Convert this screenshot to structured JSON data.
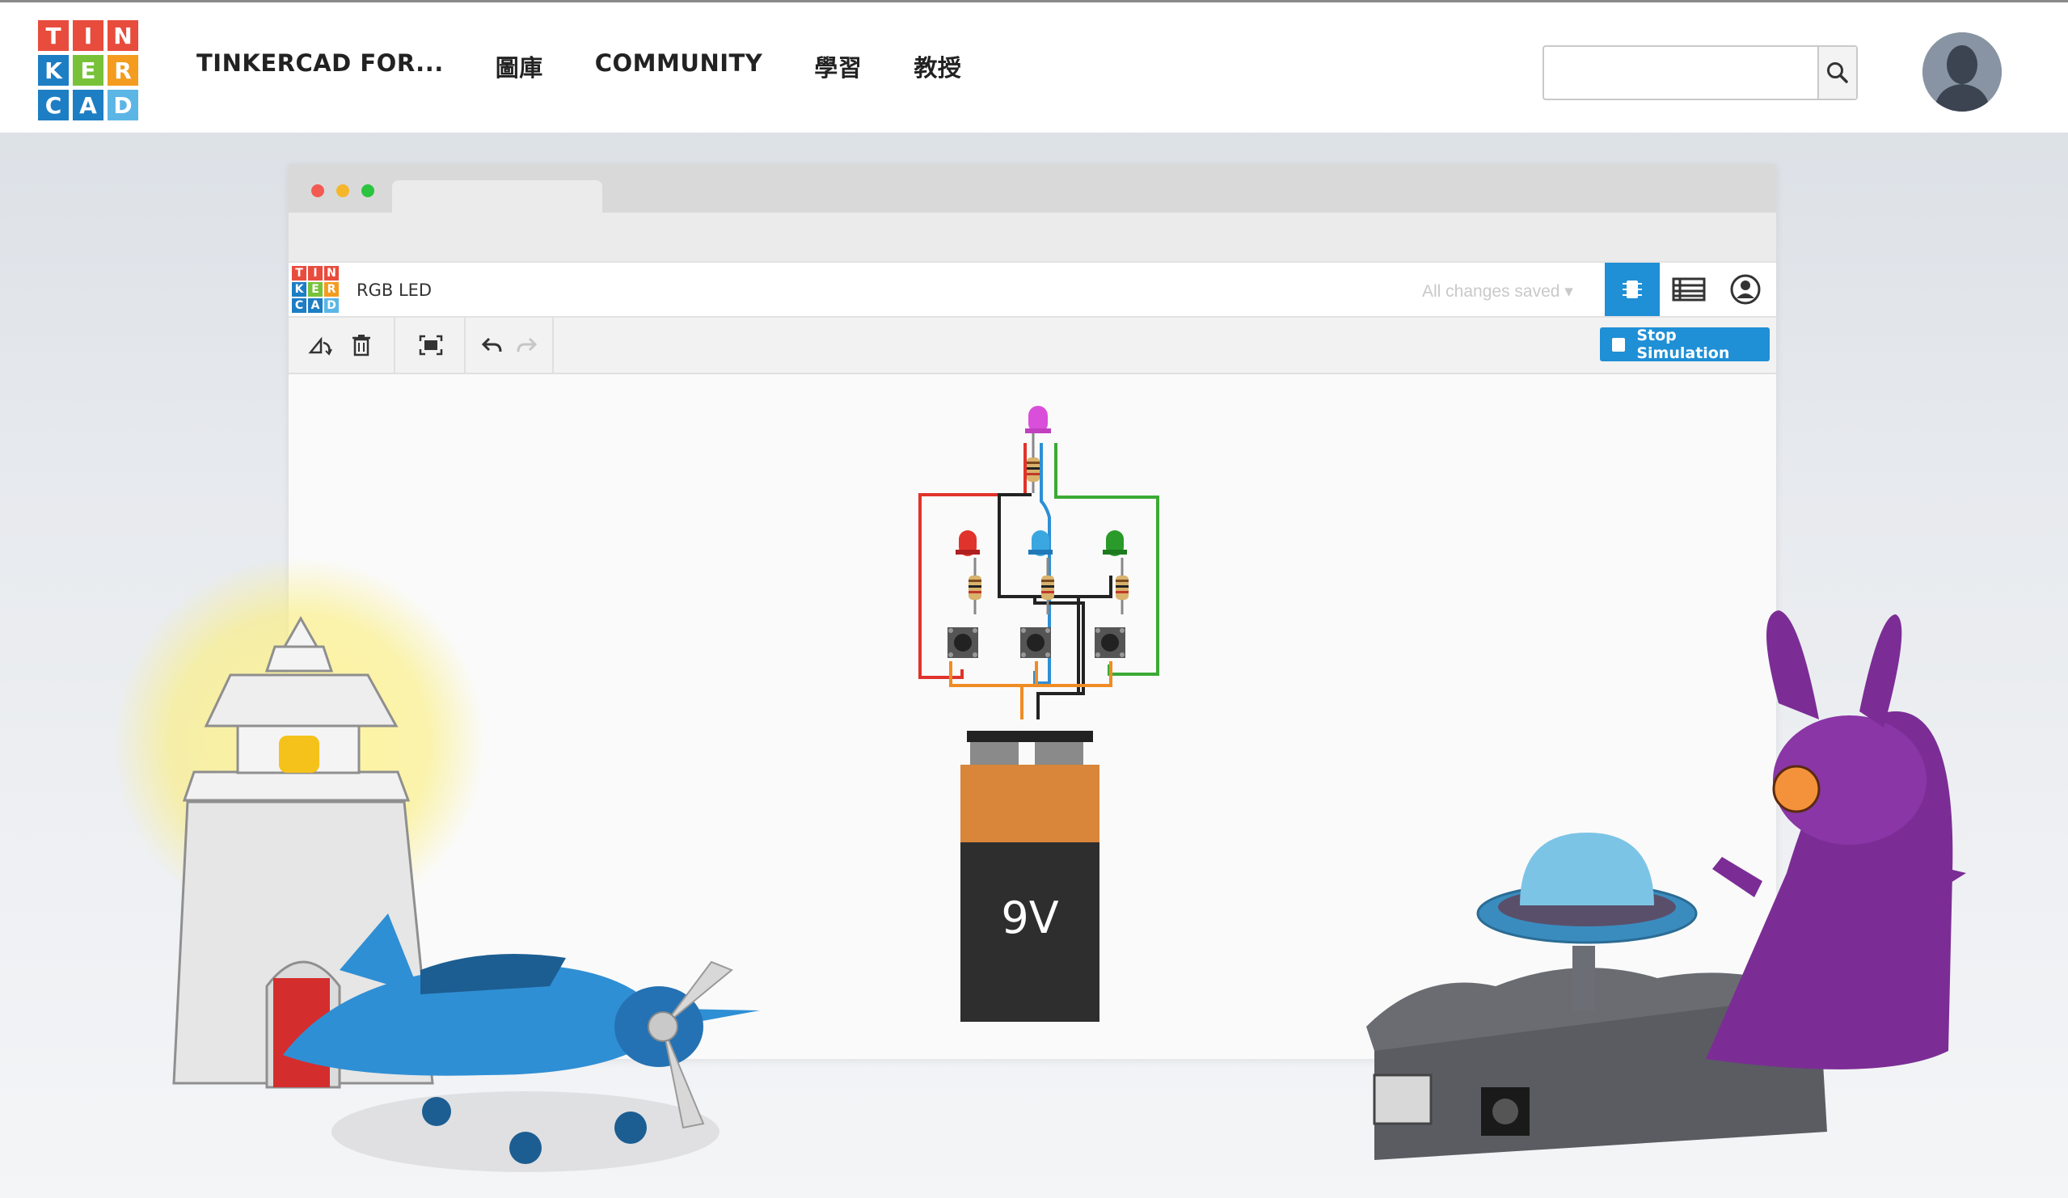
{
  "logo": {
    "letters": [
      "T",
      "I",
      "N",
      "K",
      "E",
      "R",
      "C",
      "A",
      "D"
    ],
    "colors": [
      "#e84c3d",
      "#e84c3d",
      "#e84c3d",
      "#1d7ec4",
      "#78c23a",
      "#f39c1f",
      "#1d7ec4",
      "#1d7ec4",
      "#5bb6e6"
    ]
  },
  "nav": {
    "items": [
      "TINKERCAD FOR...",
      "圖庫",
      "COMMUNITY",
      "學習",
      "教授"
    ]
  },
  "search": {
    "placeholder": "",
    "icon": "search-icon"
  },
  "user": {
    "avatar_icon": "user-avatar-icon"
  },
  "editor": {
    "project_title": "RGB LED",
    "save_status": "All changes saved",
    "view_buttons": [
      "component-view-icon",
      "component-list-icon",
      "account-icon"
    ],
    "toolbar_icons": [
      "rotate-icon",
      "delete-icon",
      "fit-view-icon",
      "undo-icon",
      "redo-icon"
    ],
    "stop_button": "Stop Simulation"
  },
  "circuit": {
    "battery_label": "9V",
    "leds": [
      "#e0332b",
      "#3aa7e0",
      "#2a9a2a"
    ],
    "rgb_led_color": "#d94fd9",
    "wire_colors": {
      "red": "#e0332b",
      "green": "#3aaa35",
      "blue": "#2d8fd6",
      "orange": "#f08c24",
      "black": "#222222"
    }
  },
  "accent": "#1f8fd6"
}
